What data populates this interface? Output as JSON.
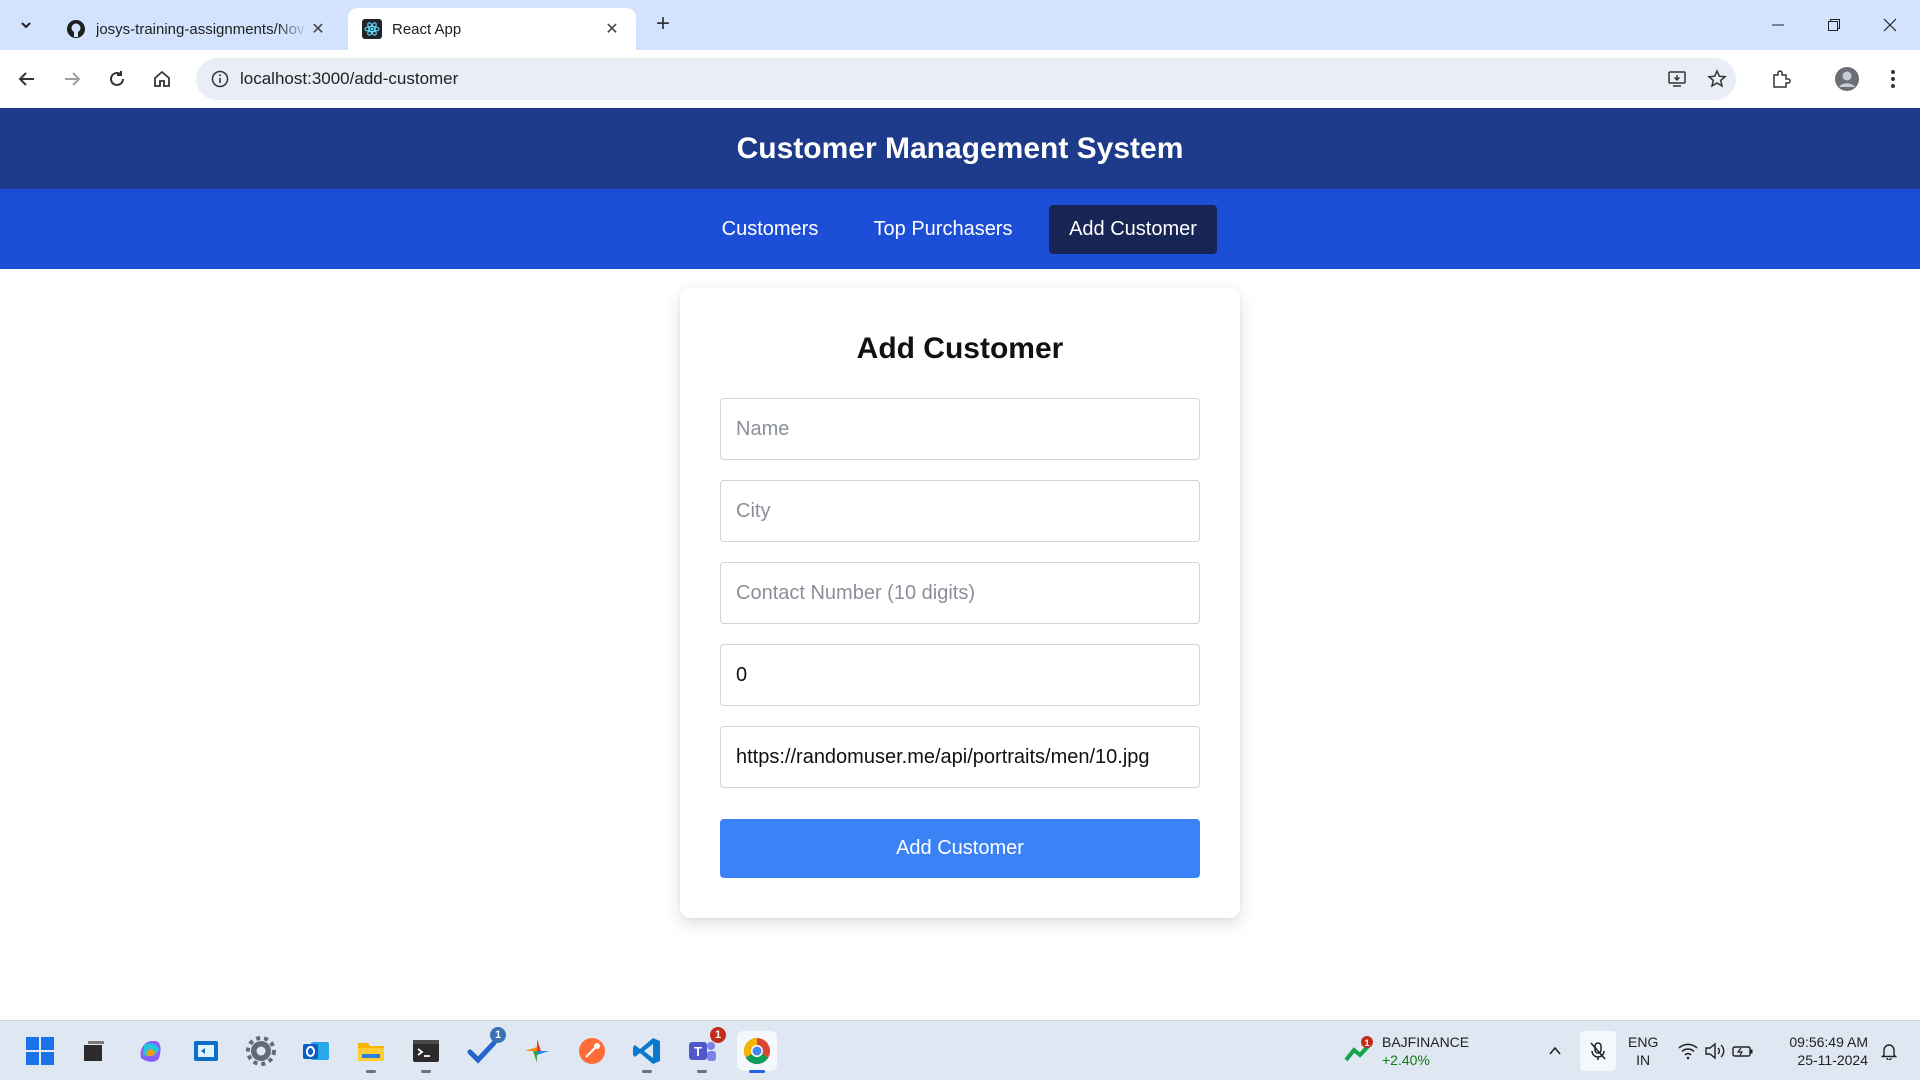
{
  "browser": {
    "tabs": [
      {
        "title": "josys-training-assignments/Nov",
        "favicon": "github-icon",
        "active": false
      },
      {
        "title": "React App",
        "favicon": "react-icon",
        "active": true
      }
    ],
    "url": "localhost:3000/add-customer"
  },
  "app": {
    "title": "Customer Management System",
    "nav": [
      {
        "label": "Customers",
        "active": false
      },
      {
        "label": "Top Purchasers",
        "active": false
      },
      {
        "label": "Add Customer",
        "active": true
      }
    ]
  },
  "form": {
    "heading": "Add Customer",
    "name": {
      "placeholder": "Name",
      "value": ""
    },
    "city": {
      "placeholder": "City",
      "value": ""
    },
    "contact": {
      "placeholder": "Contact Number (10 digits)",
      "value": ""
    },
    "purchases": {
      "value": "0"
    },
    "image_url": {
      "value": "https://randomuser.me/api/portraits/men/10.jpg"
    },
    "submit_label": "Add Customer"
  },
  "taskbar": {
    "stock": {
      "symbol": "BAJFINANCE",
      "change": "+2.40%",
      "badge": "1"
    },
    "badges": {
      "todo": "1",
      "teams": "1"
    },
    "language": {
      "line1": "ENG",
      "line2": "IN"
    },
    "time": "09:56:49 AM",
    "date": "25-11-2024"
  },
  "colors": {
    "header": "#1e3a8a",
    "nav": "#1d4ed8",
    "nav_active": "#172554",
    "button": "#3b82f6"
  }
}
